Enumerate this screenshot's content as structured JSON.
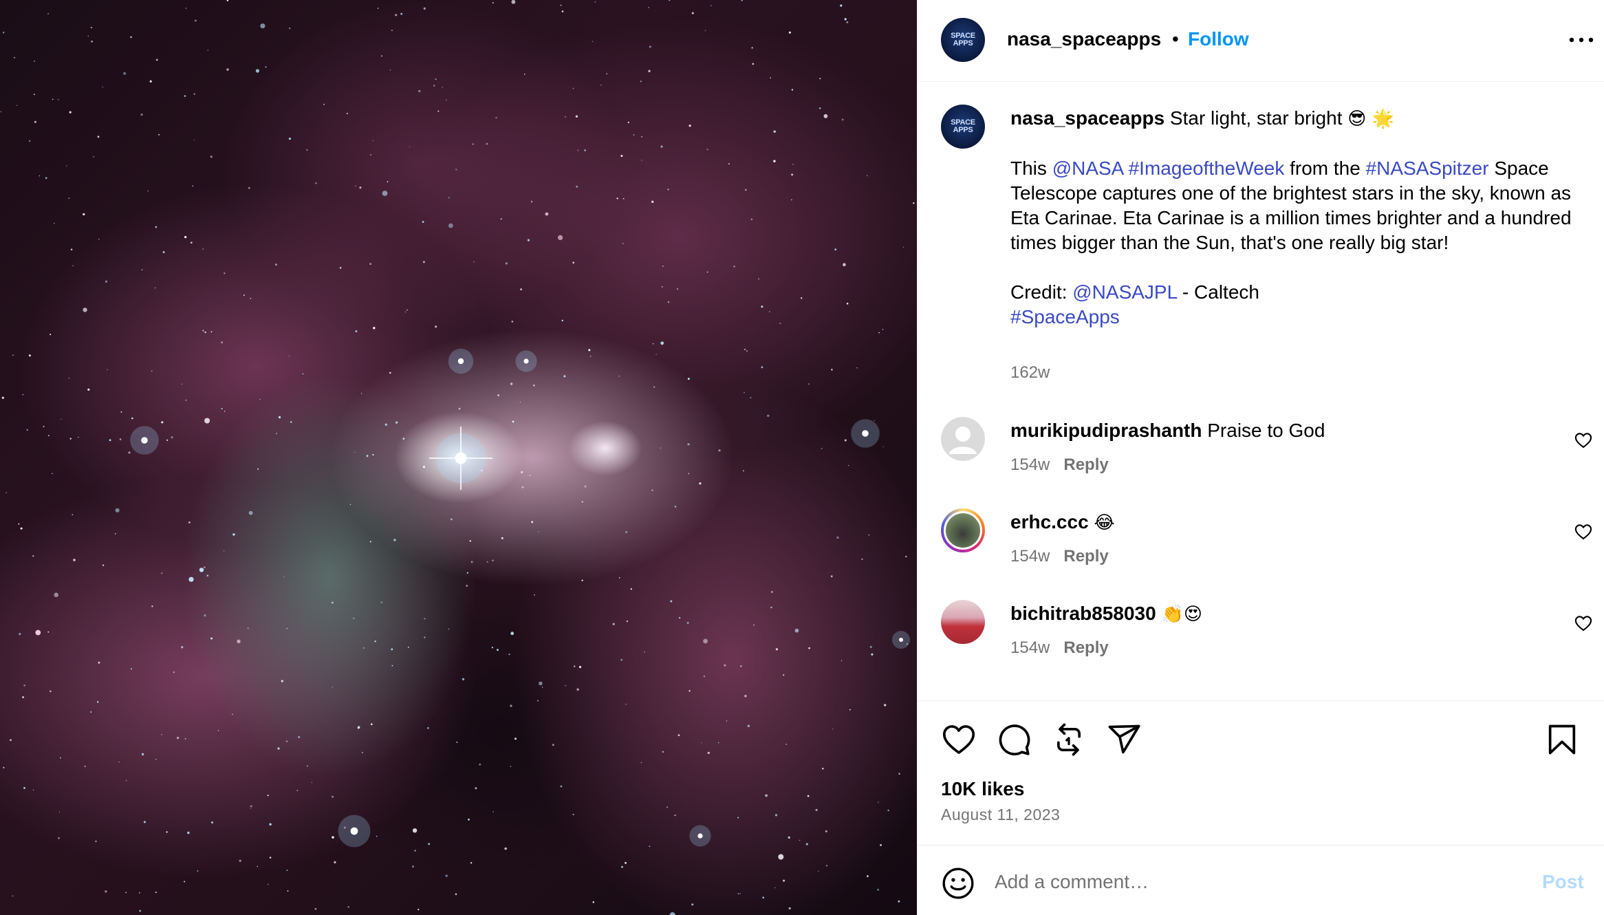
{
  "post": {
    "media_alt": "Eta Carinae nebula image from Spitzer",
    "author": "nasa_spaceapps",
    "separator": "•",
    "follow_label": "Follow",
    "more_icon": "more-horizontal-icon"
  },
  "caption": {
    "username": "nasa_spaceapps",
    "headline": "Star light, star bright",
    "headline_emoji": "😎 🌟",
    "p2_this": "This ",
    "p2_mention": "@NASA",
    "p2_space": " ",
    "p2_tag1": "#ImageoftheWeek",
    "p2_from": " from the ",
    "p2_tag2": "#NASASpitzer",
    "p2_rest": " Space Telescope captures one of the brightest stars in the sky, known as Eta Carinae. Eta Carinae is a million times brighter and a hundred times bigger than the Sun, that's one really big star!",
    "credit_label": "Credit: ",
    "credit_mention": "@NASAJPL",
    "credit_rest": " - Caltech",
    "tag": "#SpaceApps",
    "time": "162w"
  },
  "comments": [
    {
      "username": "murikipudiprashanth",
      "text": "Praise to God",
      "time": "154w",
      "reply": "Reply"
    },
    {
      "username": "erhc.ccc",
      "text": "😂",
      "time": "154w",
      "reply": "Reply"
    },
    {
      "username": "bichitrab858030",
      "text": "👏😍",
      "time": "154w",
      "reply": "Reply"
    }
  ],
  "actions": {
    "like_icon": "heart-icon",
    "comment_icon": "comment-bubble-icon",
    "repost_icon": "repost-icon",
    "share_icon": "share-paper-plane-icon",
    "save_icon": "bookmark-icon"
  },
  "likes": "10K likes",
  "date": "August 11, 2023",
  "add_comment": {
    "placeholder": "Add a comment…",
    "post_label": "Post"
  },
  "colors": {
    "link": "#3a49c4",
    "follow": "#0095f6",
    "muted": "#737373",
    "post_disabled": "#b3dbff"
  }
}
